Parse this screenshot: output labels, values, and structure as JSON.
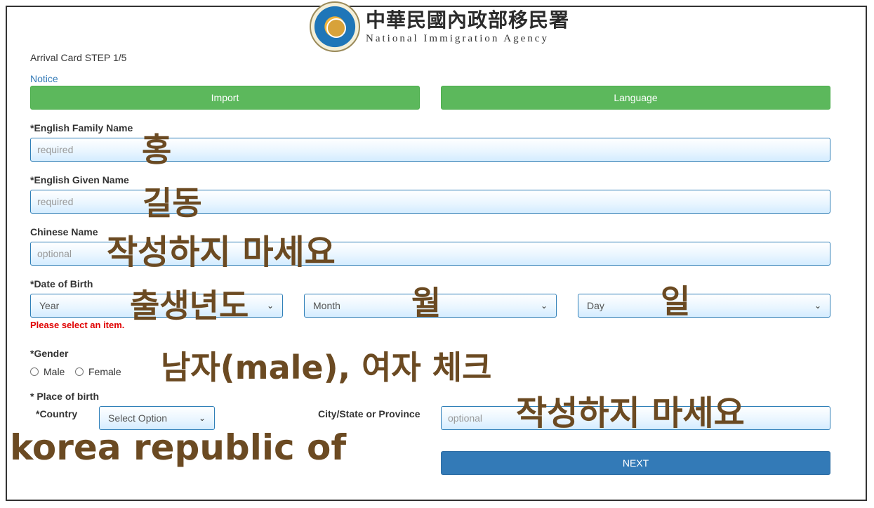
{
  "header": {
    "title_zh": "中華民國內政部移民署",
    "subtitle_en": "National Immigration Agency",
    "logo_icon": "immigration-agency-seal-icon"
  },
  "form": {
    "step_label": "Arrival Card STEP 1/5",
    "notice_link": "Notice",
    "import_button": "Import",
    "language_button": "Language",
    "family_name": {
      "label": "*English Family Name",
      "placeholder": "required",
      "value": ""
    },
    "given_name": {
      "label": "*English Given Name",
      "placeholder": "required",
      "value": ""
    },
    "chinese_name": {
      "label": "Chinese Name",
      "placeholder": "optional",
      "value": ""
    },
    "dob": {
      "label": "*Date of Birth",
      "year": "Year",
      "month": "Month",
      "day": "Day",
      "error": "Please select an item."
    },
    "gender": {
      "label": "*Gender",
      "options": [
        "Male",
        "Female"
      ]
    },
    "place_of_birth": {
      "label": "* Place of birth",
      "country_label": "*Country",
      "country_value": "Select Option",
      "city_label": "City/State or Province",
      "city_placeholder": "optional"
    },
    "next_button": "NEXT"
  },
  "annotations": {
    "family_name": "홍",
    "given_name": "길동",
    "chinese_name": "작성하지 마세요",
    "year": "출생년도",
    "month": "월",
    "day": "일",
    "gender": "남자(male), 여자  체크",
    "city": "작성하지 마세요",
    "country": "korea republic of",
    "color": "#6b4a22"
  },
  "colors": {
    "green_button": "#5cb85c",
    "blue_button": "#337ab7",
    "error": "#e00000",
    "input_border": "#2f7fb8"
  }
}
